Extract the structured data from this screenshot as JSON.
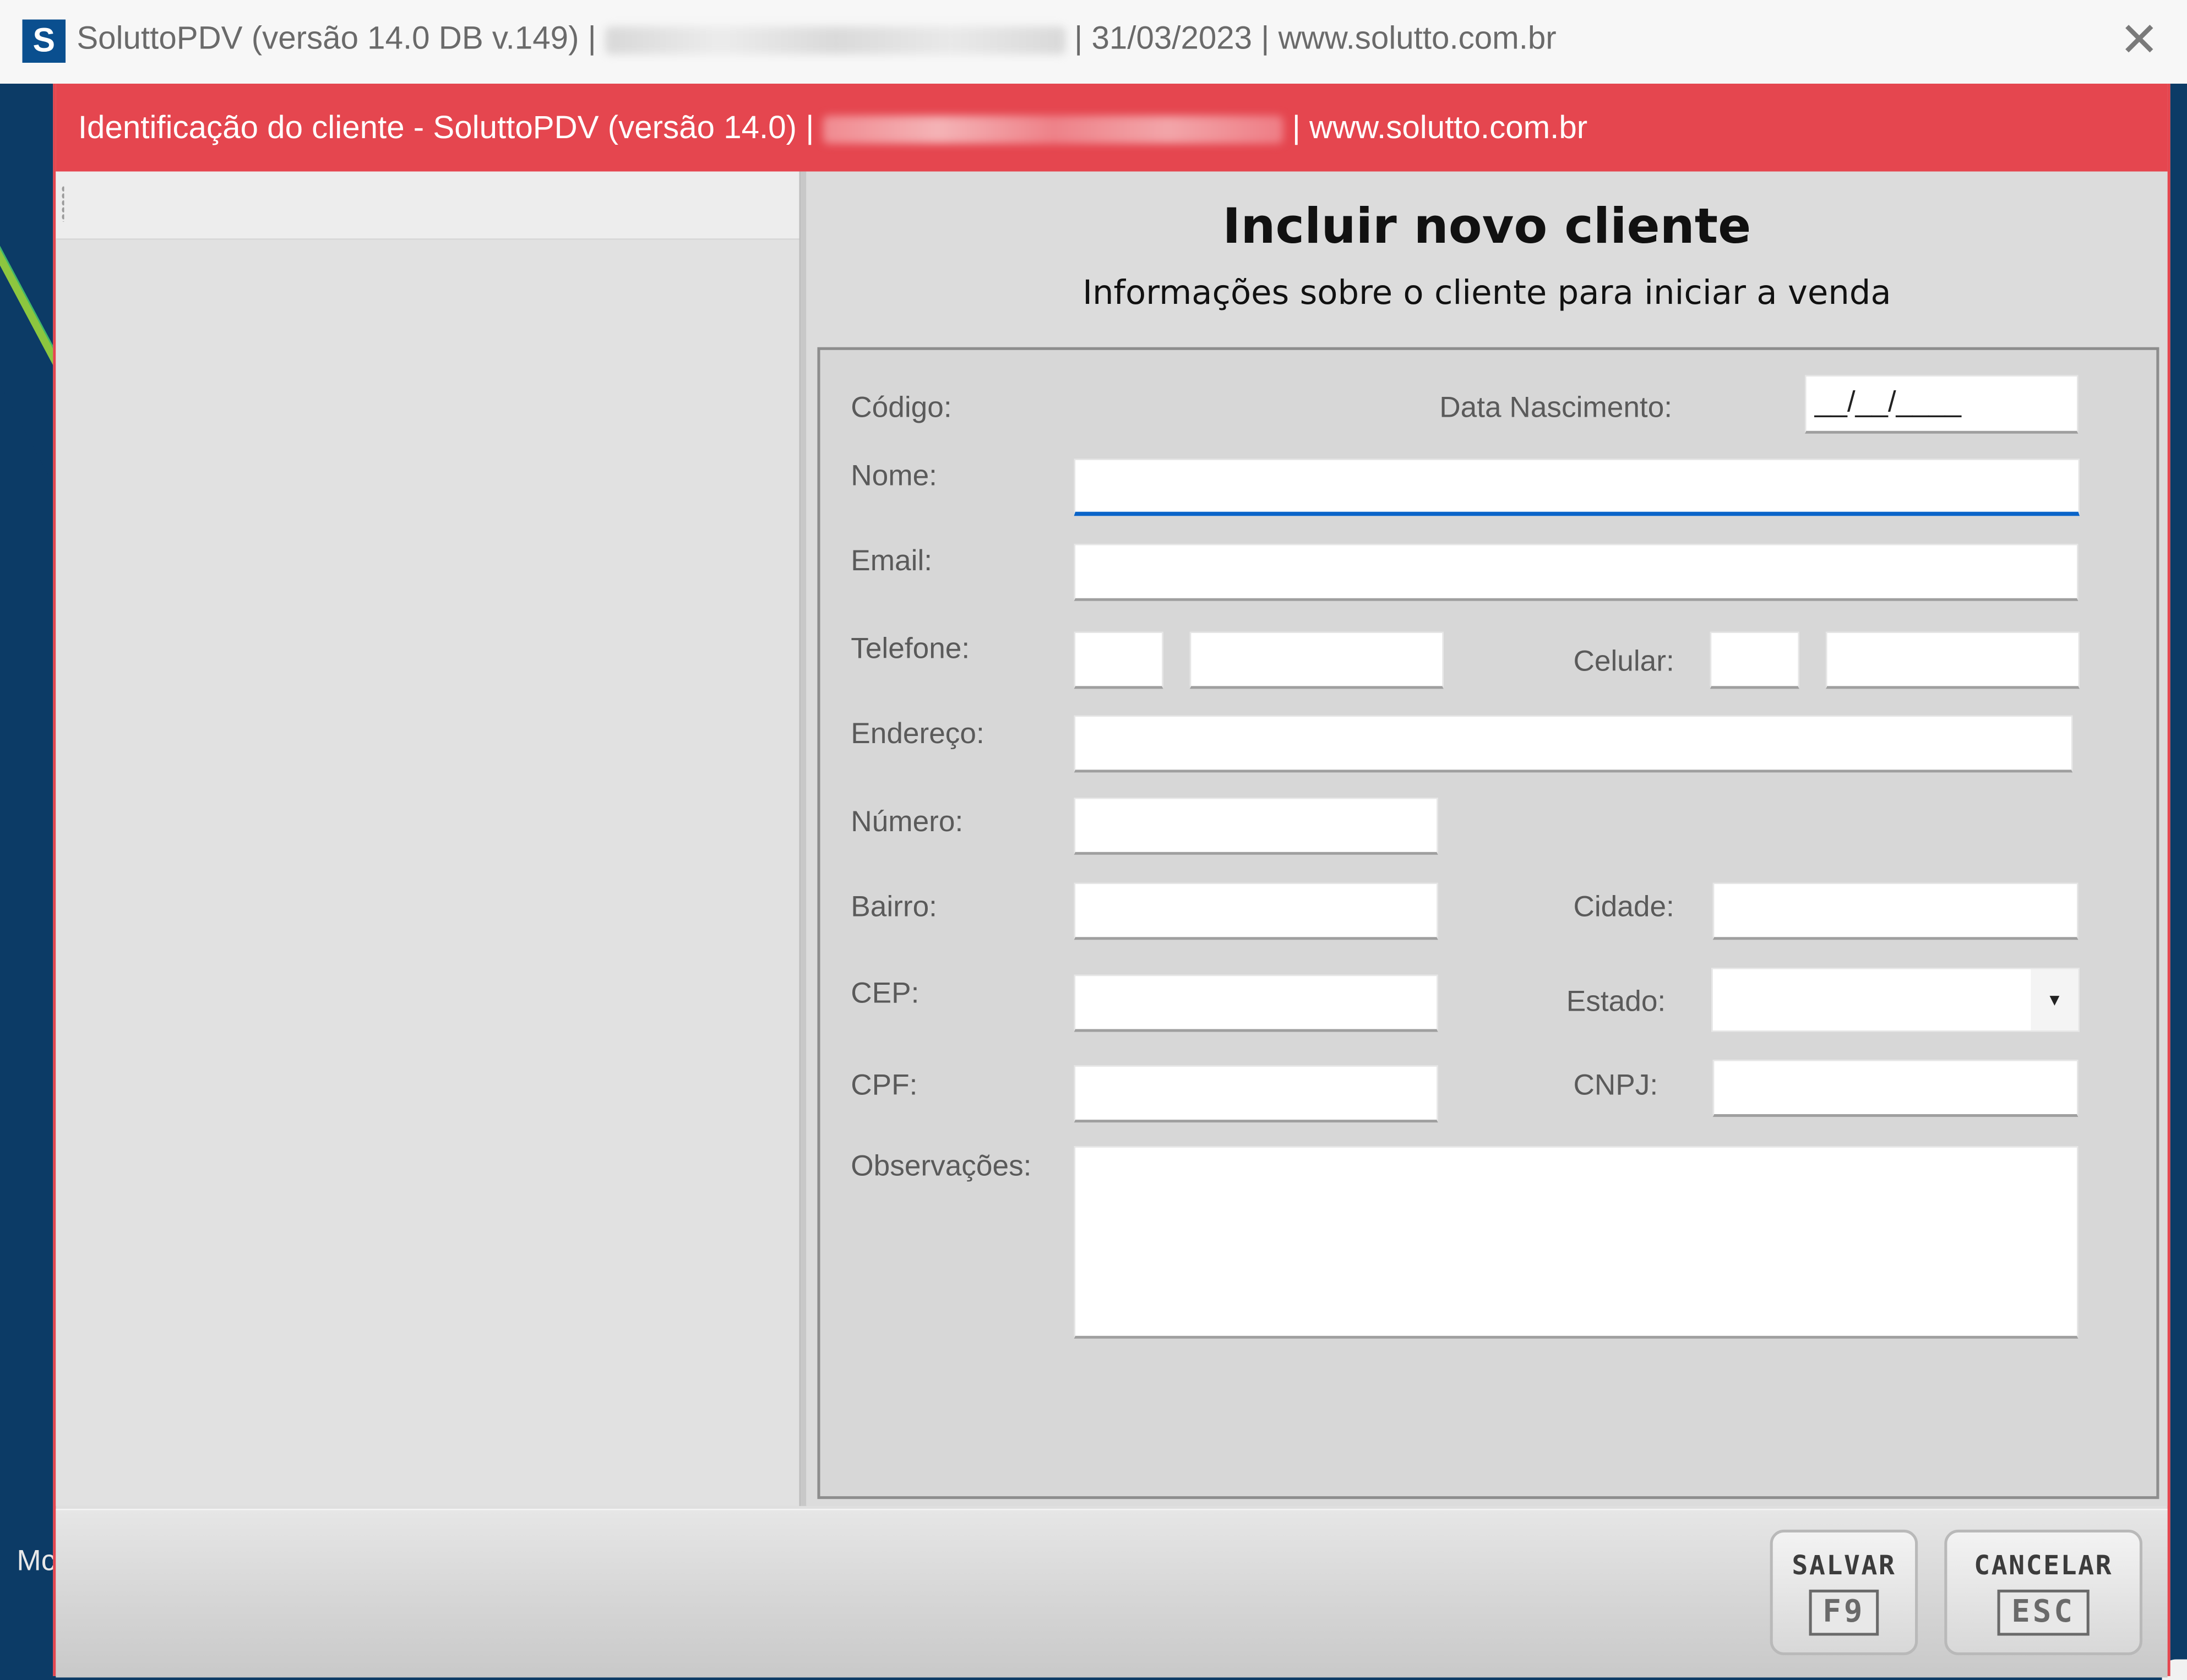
{
  "window": {
    "title_prefix": "SoluttoPDV (versão 14.0 DB v.149) |",
    "title_suffix": "| 31/03/2023 | www.solutto.com.br",
    "logo_letter": "S",
    "close_glyph": "✕"
  },
  "background": {
    "bottom_label": "Mc"
  },
  "dialog": {
    "title_prefix": "Identificação do cliente - SoluttoPDV (versão 14.0) |",
    "title_suffix": "| www.solutto.com.br",
    "accent_color": "#e5464f"
  },
  "form": {
    "heading": "Incluir novo cliente",
    "subheading": "Informações sobre o cliente para iniciar a venda",
    "labels": {
      "codigo": "Código:",
      "data_nascimento": "Data Nascimento:",
      "nome": "Nome:",
      "email": "Email:",
      "telefone": "Telefone:",
      "celular": "Celular:",
      "endereco": "Endereço:",
      "numero": "Número:",
      "bairro": "Bairro:",
      "cidade": "Cidade:",
      "cep": "CEP:",
      "estado": "Estado:",
      "cpf": "CPF:",
      "cnpj": "CNPJ:",
      "observacoes": "Observações:"
    },
    "values": {
      "data_nascimento": "__/__/____",
      "nome": "",
      "email": "",
      "telefone_ddd": "",
      "telefone": "",
      "celular_ddd": "",
      "celular": "",
      "endereco": "",
      "numero": "",
      "bairro": "",
      "cidade": "",
      "cep": "",
      "estado": "",
      "cpf": "",
      "cnpj": "",
      "observacoes": ""
    },
    "focus_color": "#0a64c8"
  },
  "buttons": {
    "save": {
      "label": "SALVAR",
      "key": "F9"
    },
    "cancel": {
      "label": "CANCELAR",
      "key": "ESC"
    }
  },
  "icons": {
    "close": "close-icon",
    "dropdown": "chevron-down-icon",
    "grip": "grip-icon",
    "logo": "app-logo-icon"
  }
}
